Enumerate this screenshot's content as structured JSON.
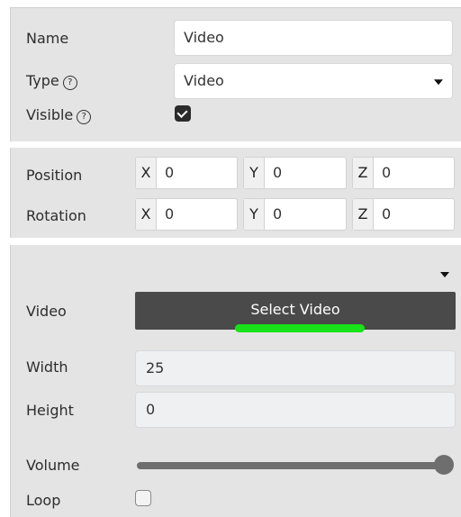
{
  "general": {
    "name_label": "Name",
    "name_value": "Video",
    "type_label": "Type",
    "type_value": "Video",
    "visible_label": "Visible",
    "visible_checked": true,
    "help_glyph": "?"
  },
  "transform": {
    "position_label": "Position",
    "rotation_label": "Rotation",
    "axes": [
      "X",
      "Y",
      "Z"
    ],
    "position": [
      "0",
      "0",
      "0"
    ],
    "rotation": [
      "0",
      "0",
      "0"
    ]
  },
  "video": {
    "video_label": "Video",
    "select_button_label": "Select Video",
    "width_label": "Width",
    "width_value": "25",
    "height_label": "Height",
    "height_value": "0",
    "volume_label": "Volume",
    "volume_level": 1.0,
    "loop_label": "Loop",
    "loop_checked": false
  },
  "colors": {
    "panel_bg": "#e4e4e4",
    "button_bg": "#4a4a4a",
    "highlight": "#18e218"
  },
  "icons": [
    "help-icon",
    "dropdown-caret-icon",
    "checkmark-icon",
    "collapse-caret-icon"
  ]
}
